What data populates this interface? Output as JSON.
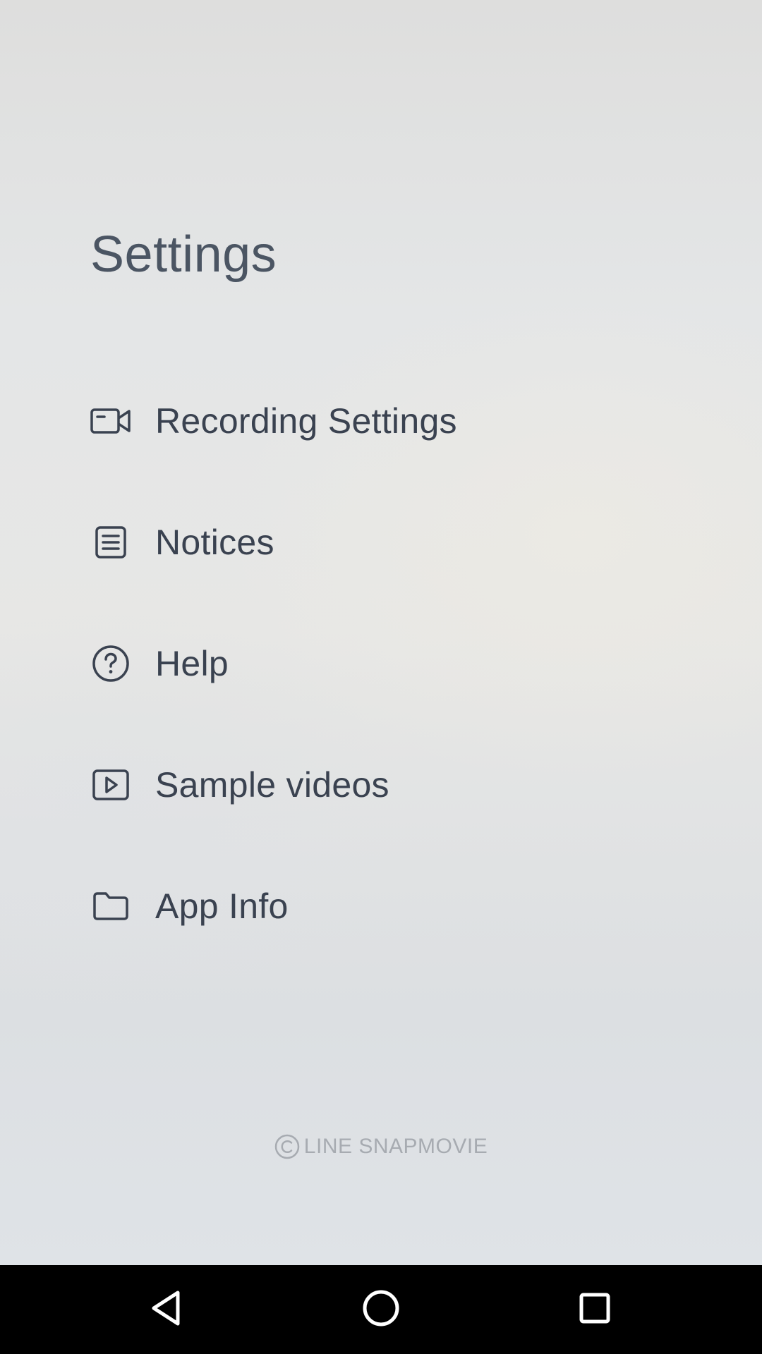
{
  "header": {
    "title": "Settings"
  },
  "menu": {
    "items": [
      {
        "label": "Recording Settings",
        "icon": "video-camera-icon"
      },
      {
        "label": "Notices",
        "icon": "document-list-icon"
      },
      {
        "label": "Help",
        "icon": "question-circle-icon"
      },
      {
        "label": "Sample videos",
        "icon": "play-box-icon"
      },
      {
        "label": "App Info",
        "icon": "folder-icon"
      }
    ]
  },
  "footer": {
    "brand": "LINE SNAPMOVIE",
    "icon": "copyright-icon"
  },
  "navbar": {
    "buttons": [
      {
        "icon": "back-triangle-icon"
      },
      {
        "icon": "home-circle-icon"
      },
      {
        "icon": "recents-square-icon"
      }
    ]
  },
  "colors": {
    "text": "#3a4250",
    "title": "#4b5563",
    "footer": "#a7abb1",
    "navbar": "#000000"
  }
}
